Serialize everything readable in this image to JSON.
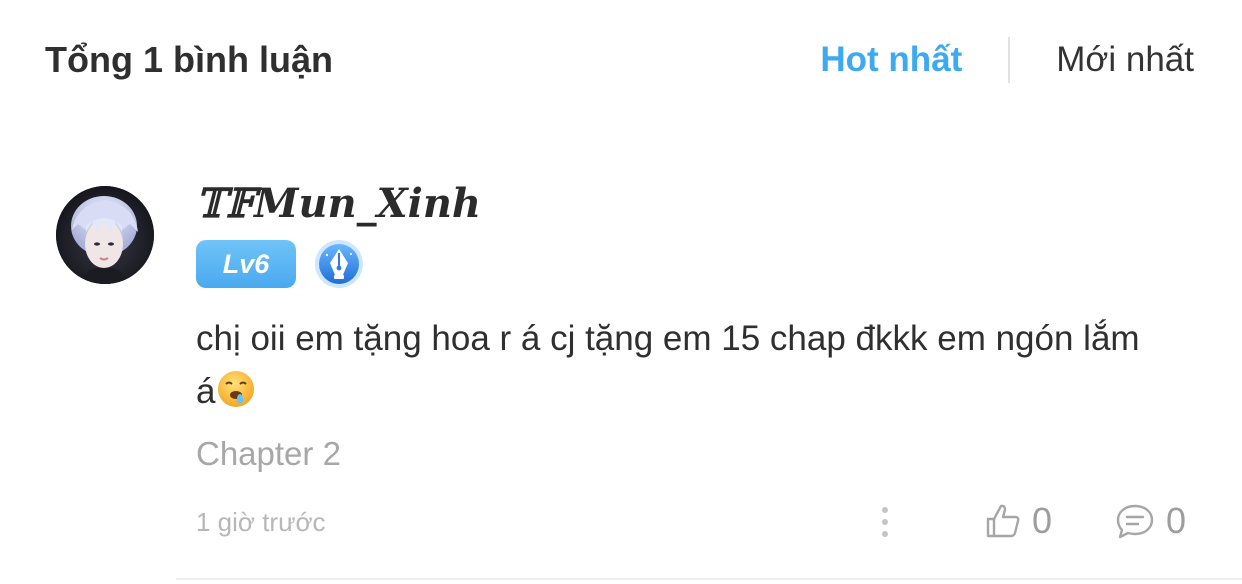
{
  "header": {
    "total_label": "Tổng 1 bình luận",
    "sort_tabs": [
      {
        "label": "Hot nhất",
        "active": true
      },
      {
        "label": "Mới nhất",
        "active": false
      }
    ]
  },
  "comment": {
    "username": "𝕋𝔽𝑴𝒖𝒏_𝑿𝒊𝒏𝒉",
    "level_badge": "Lv6",
    "text": "chị oii em tặng hoa r á cj tặng em 15 chap đkkk  em ngón lắm á",
    "emoji": "drooling-face-emoji",
    "chapter": "Chapter 2",
    "timestamp": "1 giờ trước",
    "likes": "0",
    "replies": "0"
  },
  "colors": {
    "accent": "#3da9f0",
    "level_badge": "#56b2f2",
    "muted_text": "#a7a7a7"
  },
  "icons": [
    "more-vertical-icon",
    "thumbs-up-icon",
    "chat-bubble-icon",
    "pen-nib-icon"
  ]
}
